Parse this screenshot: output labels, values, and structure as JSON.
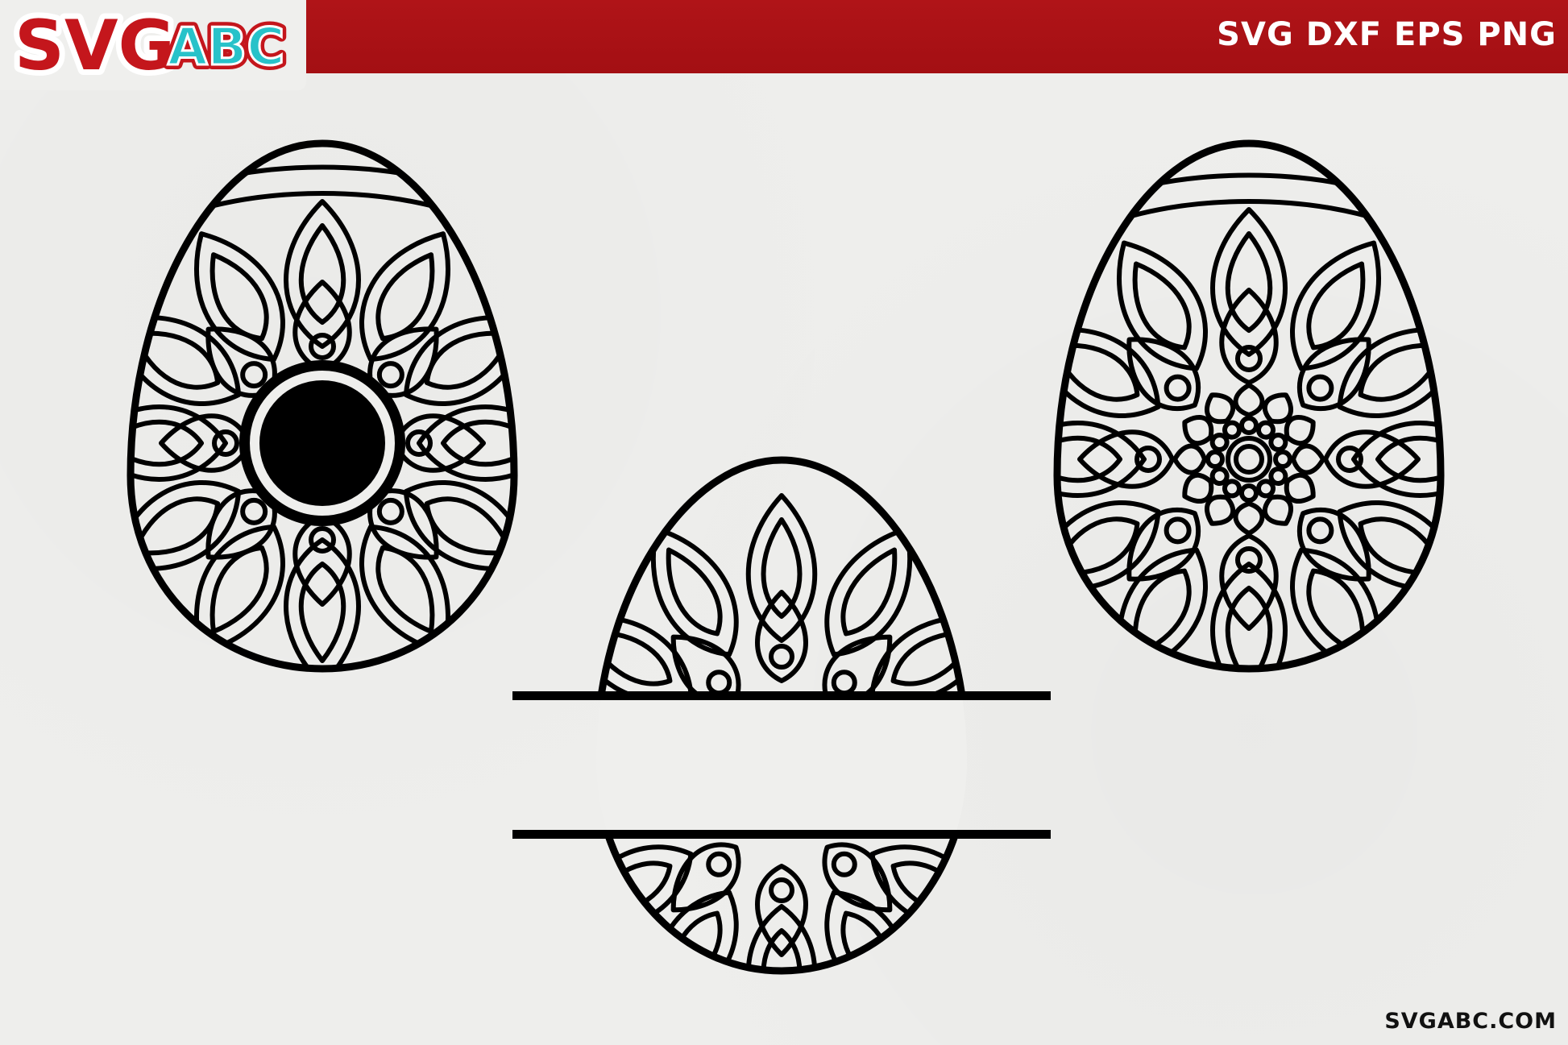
{
  "header": {
    "logo_text_part1": "SVG",
    "logo_text_part2": "ABC",
    "formats": "SVG DXF EPS PNG",
    "brand_red": "#a30f13",
    "logo_teal": "#28c2c9"
  },
  "footer": {
    "url": "SVGABC.COM"
  },
  "artwork": {
    "items": [
      {
        "name": "egg-monogram-circle"
      },
      {
        "name": "egg-split-name-frame"
      },
      {
        "name": "egg-mandala-flower"
      }
    ]
  }
}
